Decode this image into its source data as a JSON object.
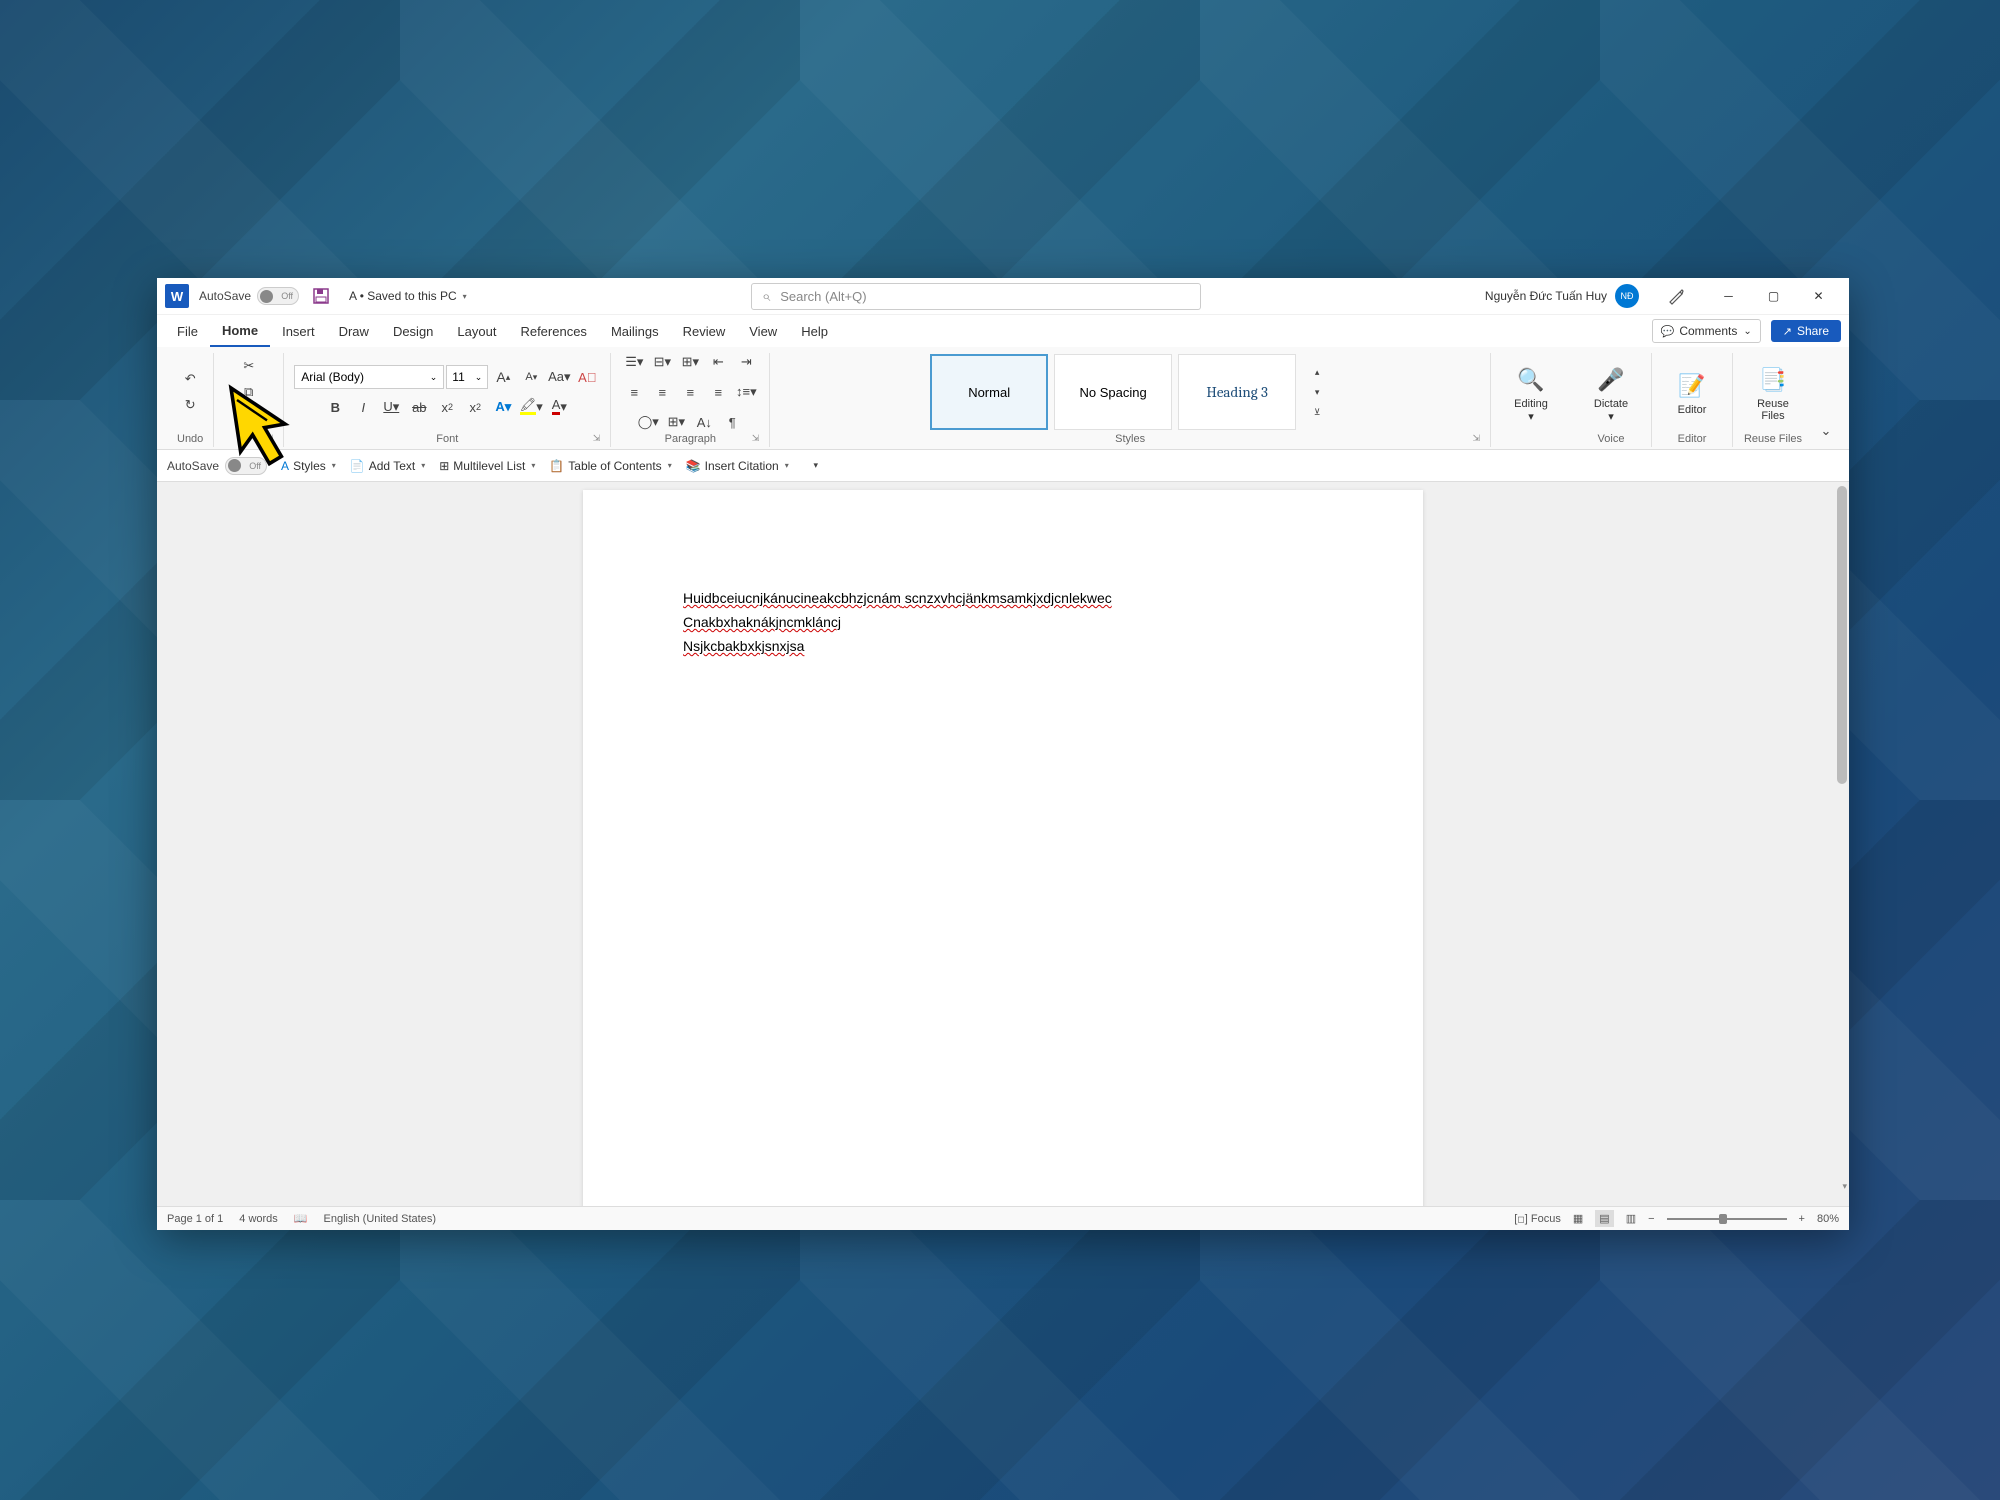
{
  "titlebar": {
    "app_initial": "W",
    "autosave_label": "AutoSave",
    "autosave_state": "Off",
    "doc_name": "A • Saved to this PC",
    "search_placeholder": "Search (Alt+Q)",
    "user_name": "Nguyễn Đức Tuấn Huy",
    "avatar_text": "NĐ"
  },
  "tabs": [
    "File",
    "Home",
    "Insert",
    "Draw",
    "Design",
    "Layout",
    "References",
    "Mailings",
    "Review",
    "View",
    "Help"
  ],
  "active_tab": "Home",
  "comments_label": "Comments",
  "share_label": "Share",
  "ribbon": {
    "undo_label": "Undo",
    "font_name": "Arial (Body)",
    "font_size": "11",
    "font_label": "Font",
    "para_label": "Paragraph",
    "styles_label": "Styles",
    "styles": [
      "Normal",
      "No Spacing",
      "Heading 3"
    ],
    "editing_label": "Editing",
    "voice_label": "Voice",
    "dictate_label": "Dictate",
    "editor_group": "Editor",
    "editor_label": "Editor",
    "reuse_group": "Reuse Files",
    "reuse_label": "Reuse\nFiles"
  },
  "quickbar": {
    "autosave": "AutoSave",
    "styles": "Styles",
    "addtext": "Add Text",
    "multilevel": "Multilevel List",
    "toc": "Table of Contents",
    "citation": "Insert Citation"
  },
  "document": {
    "line1a": "Huidbceiucnjkánucineakcbhzjcnám",
    "line1b": "scnzxvhcjänkmsamkjxdjcnlekwec",
    "line2": "Cnakbxhaknákjncmkláncj",
    "line3": "Nsjkcbakbxkjsnxjsa"
  },
  "statusbar": {
    "page": "Page 1 of 1",
    "words": "4 words",
    "language": "English (United States)",
    "focus": "Focus",
    "zoom": "80%"
  }
}
